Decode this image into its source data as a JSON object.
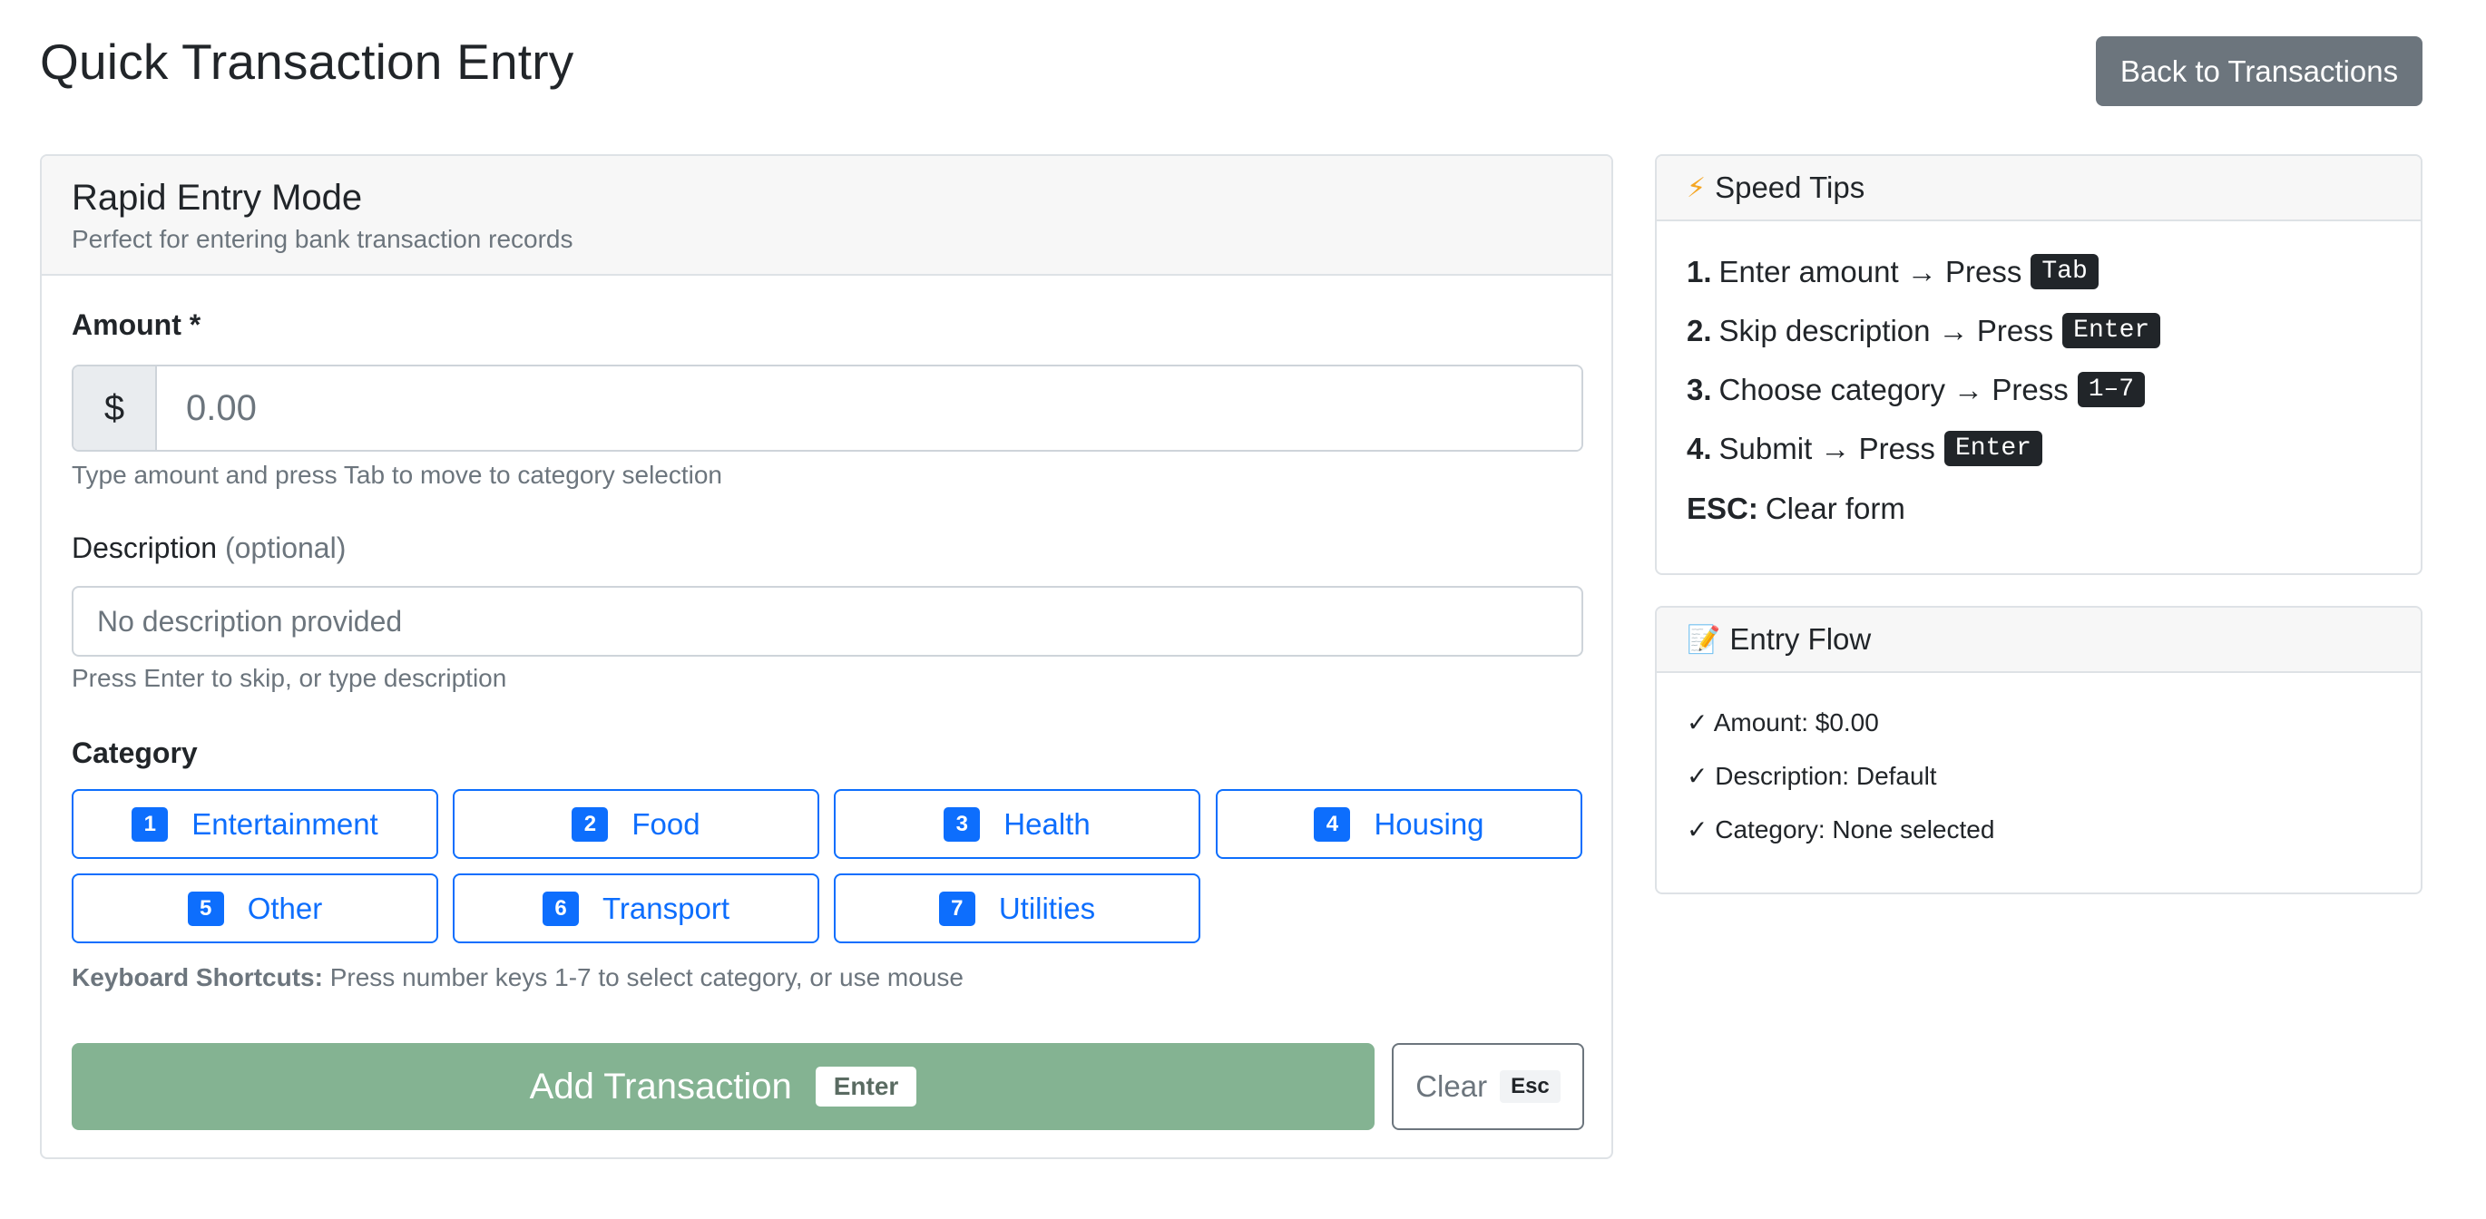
{
  "page": {
    "title": "Quick Transaction Entry",
    "back_label": "Back to Transactions"
  },
  "entry": {
    "title": "Rapid Entry Mode",
    "subtitle": "Perfect for entering bank transaction records",
    "amount": {
      "label": "Amount *",
      "prefix": "$",
      "placeholder": "0.00",
      "help": "Type amount and press Tab to move to category selection"
    },
    "description": {
      "label": "Description",
      "optional": "(optional)",
      "placeholder": "No description provided",
      "help": "Press Enter to skip, or type description"
    },
    "category": {
      "label": "Category",
      "items": [
        {
          "key": "1",
          "label": "Entertainment"
        },
        {
          "key": "2",
          "label": "Food"
        },
        {
          "key": "3",
          "label": "Health"
        },
        {
          "key": "4",
          "label": "Housing"
        },
        {
          "key": "5",
          "label": "Other"
        },
        {
          "key": "6",
          "label": "Transport"
        },
        {
          "key": "7",
          "label": "Utilities"
        }
      ],
      "shortcuts_label": "Keyboard Shortcuts:",
      "shortcuts_text": "Press number keys 1-7 to select category, or use mouse"
    },
    "submit": {
      "label": "Add Transaction",
      "key": "Enter"
    },
    "clear": {
      "label": "Clear",
      "key": "Esc"
    }
  },
  "tips": {
    "icon": "lightning-icon",
    "title": "Speed Tips",
    "items": [
      {
        "num": "1.",
        "text": "Enter amount → Press",
        "key": "Tab"
      },
      {
        "num": "2.",
        "text": "Skip description → Press",
        "key": "Enter"
      },
      {
        "num": "3.",
        "text": "Choose category → Press",
        "key": "1–7"
      },
      {
        "num": "4.",
        "text": "Submit → Press",
        "key": "Enter"
      }
    ],
    "esc_label": "ESC:",
    "esc_text": "Clear form"
  },
  "flow": {
    "icon": "memo-icon",
    "title": "Entry Flow",
    "items": [
      {
        "check": "✓",
        "text": "Amount: $0.00"
      },
      {
        "check": "✓",
        "text": "Description: Default"
      },
      {
        "check": "✓",
        "text": "Category: None selected"
      }
    ]
  },
  "colors": {
    "primary": "#0d6efd",
    "secondary": "#6c757d",
    "success_disabled": "#84b392",
    "header_bg": "#f7f7f7"
  }
}
